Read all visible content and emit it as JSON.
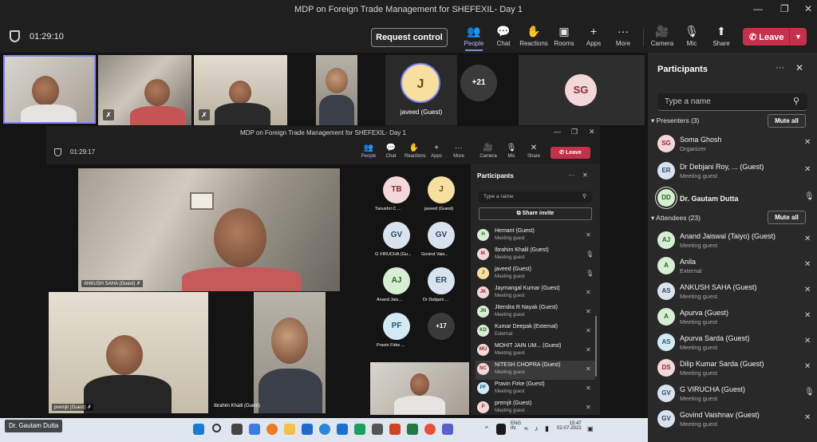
{
  "window": {
    "title": "MDP on Foreign Trade Management for SHEFEXIL- Day 1"
  },
  "toolbar": {
    "timer": "01:29:10",
    "request_control": "Request control",
    "buttons": [
      {
        "label": "People",
        "icon": "people-icon"
      },
      {
        "label": "Chat",
        "icon": "chat-icon"
      },
      {
        "label": "Reactions",
        "icon": "reactions-icon"
      },
      {
        "label": "Rooms",
        "icon": "rooms-icon"
      },
      {
        "label": "Apps",
        "icon": "apps-icon"
      },
      {
        "label": "More",
        "icon": "more-icon"
      },
      {
        "label": "Camera",
        "icon": "camera-off-icon"
      },
      {
        "label": "Mic",
        "icon": "mic-off-icon"
      },
      {
        "label": "Share",
        "icon": "share-icon"
      }
    ],
    "leave": "Leave"
  },
  "gallery": {
    "avatar_j": {
      "initials": "J",
      "name": "javeed (Guest)"
    },
    "overflow": "+21",
    "avatar_sg": {
      "initials": "SG"
    }
  },
  "inner": {
    "title": "MDP on Foreign Trade Management for SHEFEXIL- Day 1",
    "timer": "01:29:17",
    "buttons": [
      "People",
      "Chat",
      "Reactions",
      "Apps",
      "More",
      "Camera",
      "Mic",
      "Share"
    ],
    "leave": "Leave",
    "tiles": {
      "ankush": "ANKUSH SAHA (Guest)",
      "premjit": "premjit (Guest)",
      "ibrahim": "Ibrahim Khalil (Guest)"
    },
    "avatars": [
      {
        "initials": "TB",
        "name": "Tanushri C ...",
        "bg": "#f4d7d9",
        "fg": "#8a2b37"
      },
      {
        "initials": "J",
        "name": "javeed (Guest)",
        "bg": "#f6df9f",
        "fg": "#6b4a06"
      },
      {
        "initials": "GV",
        "name": "G VIRUCHA (Gu...",
        "bg": "#d9e3ef",
        "fg": "#2d4764"
      },
      {
        "initials": "GV",
        "name": "Govind Vais...",
        "bg": "#d9e3ef",
        "fg": "#2d4764"
      },
      {
        "initials": "AJ",
        "name": "Anand Jais...",
        "bg": "#d6eed2",
        "fg": "#2f5f2a"
      },
      {
        "initials": "ER",
        "name": "Dr Debjani ...",
        "bg": "#d9e3ef",
        "fg": "#2d4764"
      },
      {
        "initials": "PF",
        "name": "Pravin Firke ...",
        "bg": "#d3eaf5",
        "fg": "#1f5b78"
      }
    ],
    "overflow": "+17",
    "panel": {
      "title": "Participants",
      "search_placeholder": "Type a name",
      "share_invite": "Share invite",
      "rows": [
        {
          "initials": "H",
          "name": "Hemant (Guest)",
          "sub": "Meeting guest",
          "bg": "#d6eed2",
          "fg": "#2f5f2a"
        },
        {
          "initials": "IK",
          "name": "Ibrahim Khalil (Guest)",
          "sub": "Meeting guest",
          "bg": "#f4d7d9",
          "fg": "#8a2b37"
        },
        {
          "initials": "J",
          "name": "javeed (Guest)",
          "sub": "Meeting guest",
          "bg": "#f6df9f",
          "fg": "#6b4a06"
        },
        {
          "initials": "JK",
          "name": "Jaymangal Kumar (Guest)",
          "sub": "Meeting guest",
          "bg": "#f4d7d9",
          "fg": "#8a2b37"
        },
        {
          "initials": "JN",
          "name": "Jitendra R Nayak (Guest)",
          "sub": "Meeting guest",
          "bg": "#d6eed2",
          "fg": "#2f5f2a"
        },
        {
          "initials": "KD",
          "name": "Kumar Deepak (External)",
          "sub": "External",
          "bg": "#d6eed2",
          "fg": "#2f5f2a"
        },
        {
          "initials": "MU",
          "name": "MOHIT JAIN UM... (Guest)",
          "sub": "Meeting guest",
          "bg": "#f4d7d9",
          "fg": "#8a2b37"
        },
        {
          "initials": "NC",
          "name": "NITESH CHOPRA (Guest)",
          "sub": "Meeting guest",
          "bg": "#f4d7d9",
          "fg": "#8a2b37"
        },
        {
          "initials": "PF",
          "name": "Pravin Firke (Guest)",
          "sub": "Meeting guest",
          "bg": "#d3eaf5",
          "fg": "#1f5b78"
        },
        {
          "initials": "P",
          "name": "premjit (Guest)",
          "sub": "Meeting guest",
          "bg": "#f4d7d9",
          "fg": "#8a2b37"
        }
      ]
    }
  },
  "panel": {
    "title": "Participants",
    "search_placeholder": "Type a name",
    "presenters_heading": "Presenters (3)",
    "attendees_heading": "Attendees (23)",
    "mute_all": "Mute all",
    "presenters": [
      {
        "initials": "SG",
        "name": "Soma Ghosh",
        "sub": "Organizer",
        "bg": "#f4d7d9",
        "fg": "#8a2b37",
        "mic": "muted"
      },
      {
        "initials": "ER",
        "name": "Dr Debjani Roy, ...  (Guest)",
        "sub": "Meeting guest",
        "bg": "#d9e3ef",
        "fg": "#2d4764",
        "mic": "muted"
      },
      {
        "initials": "DD",
        "name": "Dr. Gautam Dutta",
        "sub": "",
        "bg": "#d6eed2",
        "fg": "#2f5f2a",
        "mic": "on",
        "bold": true
      }
    ],
    "attendees": [
      {
        "initials": "AJ",
        "name": "Anand Jaiswal (Taiyo) (Guest)",
        "sub": "Meeting guest",
        "bg": "#d6eed2",
        "fg": "#2f5f2a",
        "mic": "muted"
      },
      {
        "initials": "A",
        "name": "Anila",
        "sub": "External",
        "bg": "#d6eed2",
        "fg": "#2f5f2a",
        "mic": "muted"
      },
      {
        "initials": "AS",
        "name": "ANKUSH SAHA (Guest)",
        "sub": "Meeting guest",
        "bg": "#d9e3ef",
        "fg": "#2d4764",
        "mic": "muted"
      },
      {
        "initials": "A",
        "name": "Apurva (Guest)",
        "sub": "Meeting guest",
        "bg": "#d6eed2",
        "fg": "#2f5f2a",
        "mic": "muted"
      },
      {
        "initials": "AS",
        "name": "Apurva Sarda (Guest)",
        "sub": "Meeting guest",
        "bg": "#d3eaf5",
        "fg": "#1f5b78",
        "mic": "muted"
      },
      {
        "initials": "DS",
        "name": "Dilip Kumar Sarda (Guest)",
        "sub": "Meeting guest",
        "bg": "#f4d7d9",
        "fg": "#8a2b37",
        "mic": "muted"
      },
      {
        "initials": "GV",
        "name": "G VIRUCHA (Guest)",
        "sub": "Meeting guest",
        "bg": "#d9e3ef",
        "fg": "#2d4764",
        "mic": "on"
      },
      {
        "initials": "GV",
        "name": "Govind Vaishnav (Guest)",
        "sub": "Meeting guest",
        "bg": "#d9e3ef",
        "fg": "#2d4764",
        "mic": "muted"
      }
    ]
  },
  "speaker_tag": "Dr. Gautam Dutta",
  "taskbar": {
    "lang": "ENG",
    "region": "IN",
    "time": "15:47",
    "date": "02-07-2022"
  }
}
